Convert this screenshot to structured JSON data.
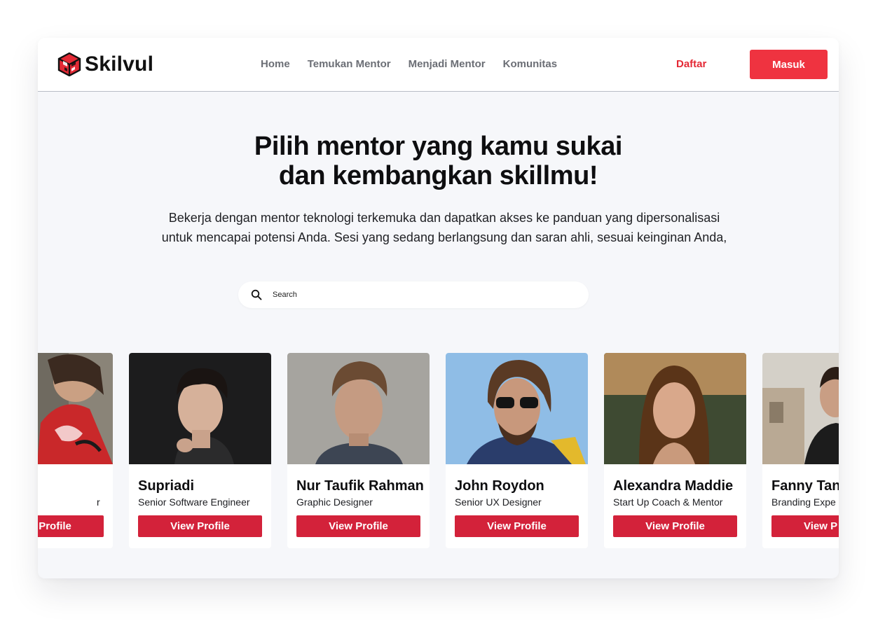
{
  "brand": {
    "name": "Skilvul",
    "accent": "#ef3340"
  },
  "nav": {
    "links": [
      "Home",
      "Temukan Mentor",
      "Menjadi Mentor",
      "Komunitas"
    ],
    "register_label": "Daftar",
    "login_label": "Masuk"
  },
  "hero": {
    "title_line1": "Pilih mentor yang kamu sukai",
    "title_line2": "dan kembangkan skillmu!",
    "subtitle_line1": "Bekerja dengan mentor teknologi terkemuka dan dapatkan akses ke panduan yang dipersonalisasi",
    "subtitle_line2": "untuk mencapai potensi Anda. Sesi yang sedang berlangsung dan saran ahli, sesuai keinginan Anda,"
  },
  "search": {
    "placeholder": "Search",
    "icon": "search-icon"
  },
  "mentors": [
    {
      "name": "",
      "role": "r",
      "button": "View Profile"
    },
    {
      "name": "Supriadi",
      "role": "Senior Software Engineer",
      "button": "View Profile"
    },
    {
      "name": "Nur Taufik Rahman",
      "role": "Graphic Designer",
      "button": "View Profile"
    },
    {
      "name": "John Roydon",
      "role": "Senior UX Designer",
      "button": "View Profile"
    },
    {
      "name": "Alexandra Maddie",
      "role": "Start Up Coach & Mentor",
      "button": "View Profile"
    },
    {
      "name": "Fanny Tan",
      "role": "Branding Expe",
      "button": "View P"
    }
  ]
}
